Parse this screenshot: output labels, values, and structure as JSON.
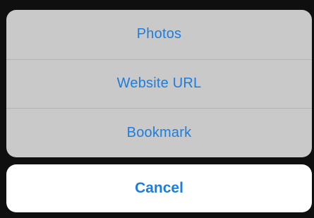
{
  "action_sheet": {
    "items": [
      {
        "label": "Photos"
      },
      {
        "label": "Website URL"
      },
      {
        "label": "Bookmark"
      }
    ],
    "cancel_label": "Cancel"
  },
  "colors": {
    "accent": "#1d7ddd",
    "sheet_background": "#c9c9c9",
    "cancel_background": "#ffffff",
    "backdrop": "#0f0f10"
  }
}
